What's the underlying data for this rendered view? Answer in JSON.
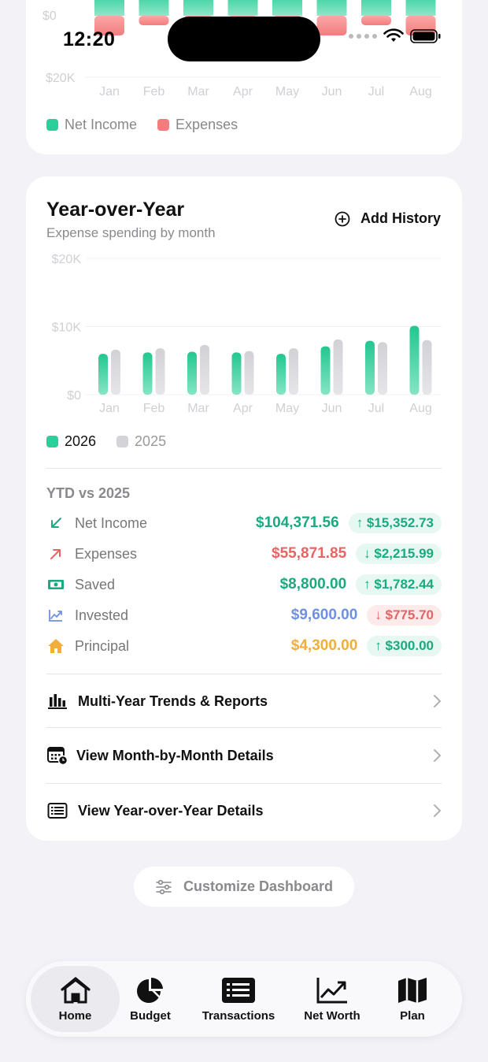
{
  "status_bar": {
    "time": "12:20"
  },
  "top_chart": {
    "y_labels": [
      "$0",
      "$20K"
    ],
    "months": [
      "Jan",
      "Feb",
      "Mar",
      "Apr",
      "May",
      "Jun",
      "Jul",
      "Aug"
    ],
    "legend": [
      {
        "label": "Net Income",
        "color": "#2bcf9a"
      },
      {
        "label": "Expenses",
        "color": "#f47c7c"
      }
    ]
  },
  "yoy": {
    "title": "Year-over-Year",
    "subtitle": "Expense spending by month",
    "add_history_label": "Add History",
    "legend_2026": "2026",
    "legend_2025": "2025",
    "ytd_title": "YTD vs 2025",
    "rows": [
      {
        "label": "Net Income",
        "value": "$104,371.56",
        "delta": "↑ $15,352.73",
        "value_color": "#1aaa7f",
        "icon": "arrow-down-left-icon"
      },
      {
        "label": "Expenses",
        "value": "$55,871.85",
        "delta": "↓ $2,215.99",
        "value_color": "#e96363",
        "icon": "arrow-up-right-icon"
      },
      {
        "label": "Saved",
        "value": "$8,800.00",
        "delta": "↑ $1,782.44",
        "value_color": "#1aaa7f",
        "icon": "cash-icon"
      },
      {
        "label": "Invested",
        "value": "$9,600.00",
        "delta": "↓ $775.70",
        "value_color": "#6f8fe0",
        "icon": "chart-line-icon"
      },
      {
        "label": "Principal",
        "value": "$4,300.00",
        "delta": "↑ $300.00",
        "value_color": "#f2ad3a",
        "icon": "house-icon"
      }
    ],
    "links": [
      {
        "label": "Multi-Year Trends & Reports",
        "icon": "bar-chart-icon"
      },
      {
        "label": "View Month-by-Month Details",
        "icon": "calendar-clock-icon"
      },
      {
        "label": "View Year-over-Year Details",
        "icon": "list-icon"
      }
    ]
  },
  "chart_data": {
    "type": "bar",
    "categories": [
      "Jan",
      "Feb",
      "Mar",
      "Apr",
      "May",
      "Jun",
      "Jul",
      "Aug"
    ],
    "series": [
      {
        "name": "2026",
        "values": [
          6000,
          6200,
          6300,
          6200,
          6000,
          7100,
          7900,
          10100
        ],
        "color": "#2bcf9a"
      },
      {
        "name": "2025",
        "values": [
          6600,
          6800,
          7300,
          6400,
          6800,
          8100,
          7700,
          8000
        ],
        "color": "#d4d4d8"
      }
    ],
    "ylim": [
      0,
      20000
    ],
    "y_ticks": [
      "$0",
      "$10K",
      "$20K"
    ],
    "grid": true,
    "legend": "bottom-left"
  },
  "customize_label": "Customize Dashboard",
  "tabs": [
    {
      "label": "Home",
      "icon": "home-icon",
      "active": true
    },
    {
      "label": "Budget",
      "icon": "pie-chart-icon"
    },
    {
      "label": "Transactions",
      "icon": "transactions-icon"
    },
    {
      "label": "Net Worth",
      "icon": "net-worth-chart-icon"
    },
    {
      "label": "Plan",
      "icon": "map-icon"
    }
  ]
}
